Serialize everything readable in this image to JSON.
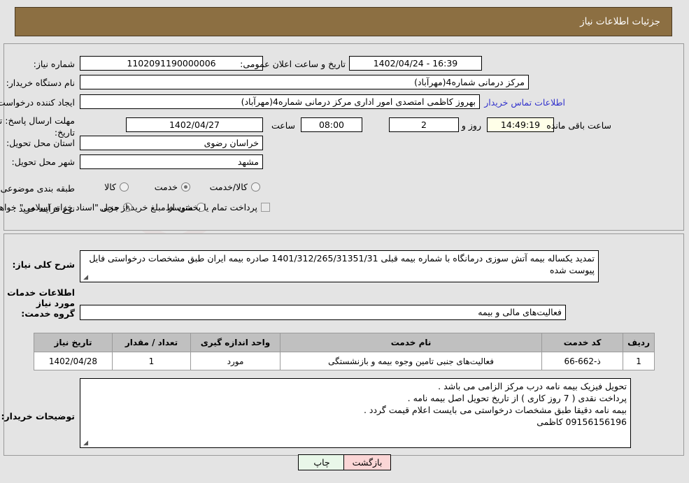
{
  "header": {
    "title": "جزئیات اطلاعات نیاز"
  },
  "watermark": {
    "text": "AriaTender.net"
  },
  "top_section": {
    "need_number": {
      "label": "شماره نیاز:",
      "value": "1102091190000006"
    },
    "public_announcement": {
      "label": "تاریخ و ساعت اعلان عمومی:",
      "value": "16:39 - 1402/04/24"
    },
    "buyer_org": {
      "label": "نام دستگاه خریدار:",
      "value": "مرکز درمانی شماره4(مهرآباد)"
    },
    "request_creator": {
      "label": "ایجاد کننده درخواست:",
      "value": "بهروز کاظمی امتصدی امور اداری مرکز درمانی شماره4(مهرآباد)"
    },
    "buyer_contact_link": "اطلاعات تماس خریدار",
    "response_deadline": {
      "label": "مهلت ارسال پاسخ: تا تاریخ:",
      "date": "1402/04/27",
      "time_label": "ساعت",
      "time": "08:00",
      "days": "2",
      "days_label": "روز و",
      "countdown": "14:49:19",
      "remaining_label": "ساعت باقی مانده"
    },
    "delivery_province": {
      "label": "استان محل تحویل:",
      "value": "خراسان رضوی"
    },
    "delivery_city": {
      "label": "شهر محل تحویل:",
      "value": "مشهد"
    },
    "subject_classification": {
      "label": "طبقه بندی موضوعی:",
      "options": [
        {
          "label": "کالا",
          "selected": false
        },
        {
          "label": "خدمت",
          "selected": true
        },
        {
          "label": "کالا/خدمت",
          "selected": false
        }
      ]
    },
    "purchase_process": {
      "label": "نوع فرآیند خرید :",
      "options": [
        {
          "label": "جزیی",
          "selected": true
        },
        {
          "label": "متوسط",
          "selected": false
        }
      ],
      "note": "پرداخت تمام یا بخشی از مبلغ خرید،از محل \"اسناد خزانه اسلامی\" خواهد بود.",
      "note_checked": false
    }
  },
  "bottom_section": {
    "general_description": {
      "label": "شرح کلی نیاز:",
      "value": "تمدید یکساله بیمه آتش سوزی درمانگاه با شماره بیمه قبلی 1401/312/265/31351/31 صادره بیمه ایران طبق مشخصات درخواستی فایل پیوست شده"
    },
    "services_title": "اطلاعات خدمات مورد نیاز",
    "service_group": {
      "label": "گروه خدمت:",
      "value": "فعالیت‌های مالی و بیمه"
    },
    "table": {
      "headers": [
        "ردیف",
        "کد خدمت",
        "نام خدمت",
        "واحد اندازه گیری",
        "تعداد / مقدار",
        "تاریخ نیاز"
      ],
      "rows": [
        {
          "row": "1",
          "service_code": "ذ-662-66",
          "service_name": "فعالیت‌های جنبی تامین وجوه بیمه و بازنشستگی",
          "unit": "مورد",
          "quantity": "1",
          "need_date": "1402/04/28"
        }
      ]
    },
    "buyer_notes": {
      "label": "توضیحات خریدار:",
      "lines": [
        "تحویل فیزیک بیمه نامه درب مرکز الزامی می باشد .",
        "پرداخت نقدی ( 7 روز کاری ) از تاریخ تحویل اصل بیمه نامه .",
        "بیمه نامه دقیقا طبق مشخصات درخواستی می بایست اعلام قیمت گردد .",
        "09156156196 کاظمی"
      ]
    }
  },
  "footer": {
    "print_button": "چاپ",
    "back_button": "بازگشت"
  },
  "colors": {
    "header_bg": "#8C6F42",
    "page_bg": "#E4E4E4",
    "table_header_bg": "#C0C0C0",
    "link": "#3333CC",
    "timer_bg": "#FFFFE8",
    "print_btn": "#E9F7E9",
    "back_btn": "#FBD6D6"
  }
}
